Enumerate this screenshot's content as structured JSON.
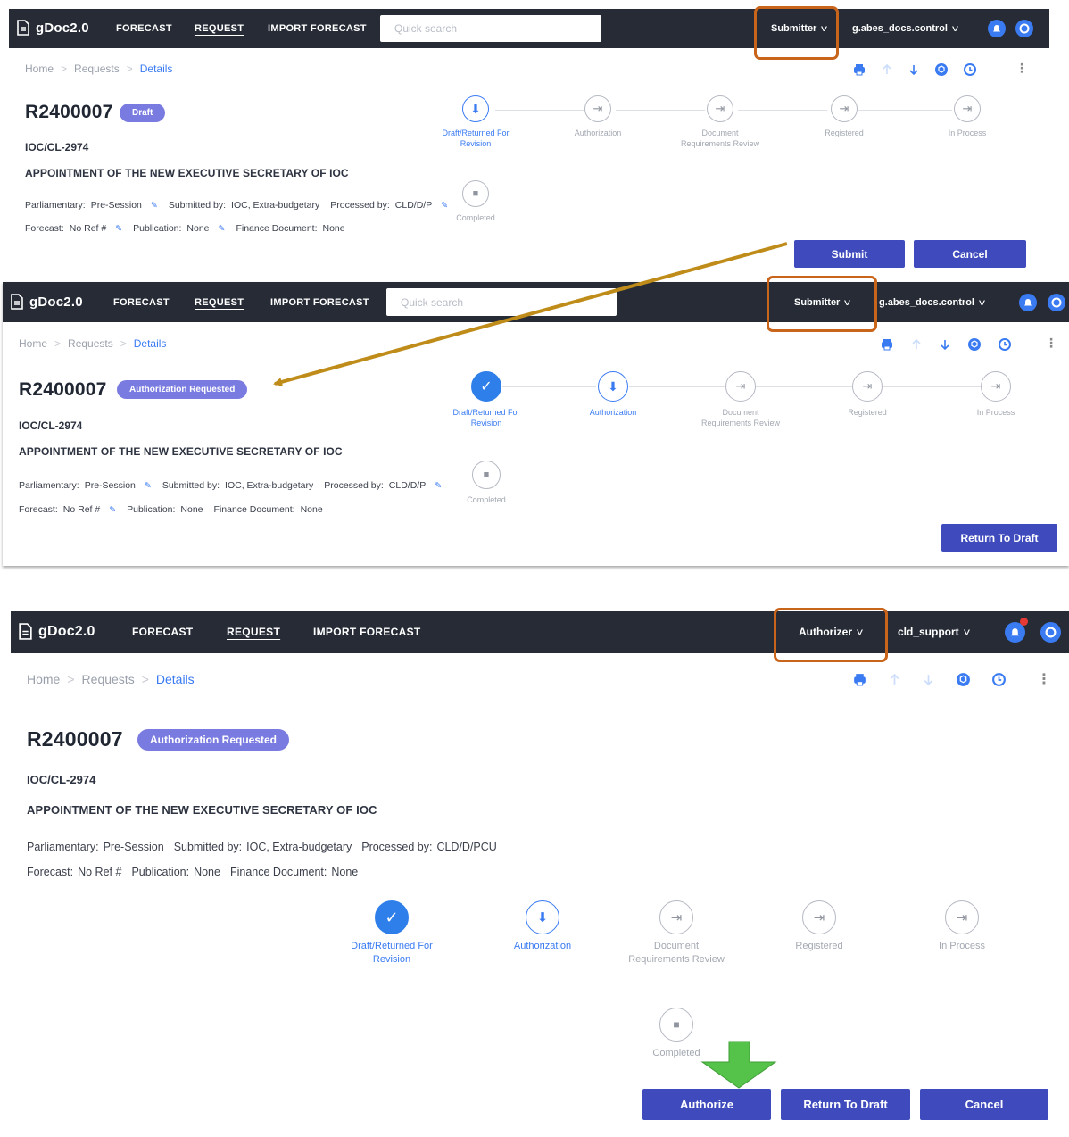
{
  "app_name": "gDoc2.0",
  "nav": {
    "forecast": "FORECAST",
    "request": "REQUEST",
    "import_forecast": "IMPORT FORECAST"
  },
  "search": {
    "placeholder": "Quick search"
  },
  "breadcrumb": {
    "home": "Home",
    "requests": "Requests",
    "details": "Details",
    "sep": ">"
  },
  "request": {
    "id": "R2400007",
    "symbol": "IOC/CL-2974",
    "title": "APPOINTMENT OF THE NEW EXECUTIVE SECRETARY OF IOC",
    "parliamentary_label": "Parliamentary:",
    "parliamentary_value": "Pre-Session",
    "submitted_label": "Submitted by:",
    "submitted_value": "IOC, Extra-budgetary",
    "processed_label": "Processed by:",
    "processed_value_short": "CLD/D/P",
    "processed_value": "CLD/D/PCU",
    "forecast_label": "Forecast:",
    "forecast_value": "No Ref #",
    "publication_label": "Publication:",
    "publication_value": "None",
    "finance_label": "Finance Document:",
    "finance_value": "None"
  },
  "steps": {
    "draft_1": "Draft/Returned For",
    "draft_2": "Revision",
    "authorization": "Authorization",
    "docreq_1": "Document",
    "docreq_2": "Requirements Review",
    "registered": "Registered",
    "in_process": "In Process",
    "completed": "Completed"
  },
  "panel1": {
    "role": "Submitter",
    "user": "g.abes_docs.control",
    "status": "Draft",
    "buttons": {
      "submit": "Submit",
      "cancel": "Cancel"
    }
  },
  "panel2": {
    "role": "Submitter",
    "user": "g.abes_docs.control",
    "status": "Authorization Requested",
    "buttons": {
      "return_to_draft": "Return To Draft"
    }
  },
  "panel3": {
    "role": "Authorizer",
    "user": "cld_support",
    "status": "Authorization Requested",
    "buttons": {
      "authorize": "Authorize",
      "return_to_draft": "Return To Draft",
      "cancel": "Cancel"
    }
  },
  "colors": {
    "topbar": "#262b36",
    "accent": "#3a7bf2",
    "button": "#3f4bbd",
    "status_pill": "#7a7be0",
    "highlight": "#c9641b",
    "arrow": "#bf8c1a",
    "down_arrow": "#55c24a"
  },
  "icons": {
    "logo": "document-icon",
    "chevron": "chevron-down-icon",
    "bell": "bell-icon",
    "help": "help-icon",
    "print": "print-icon",
    "up": "arrow-up-icon",
    "down": "arrow-down-icon",
    "cube": "cube-icon",
    "history": "clock-icon",
    "more": "kebab-icon"
  }
}
